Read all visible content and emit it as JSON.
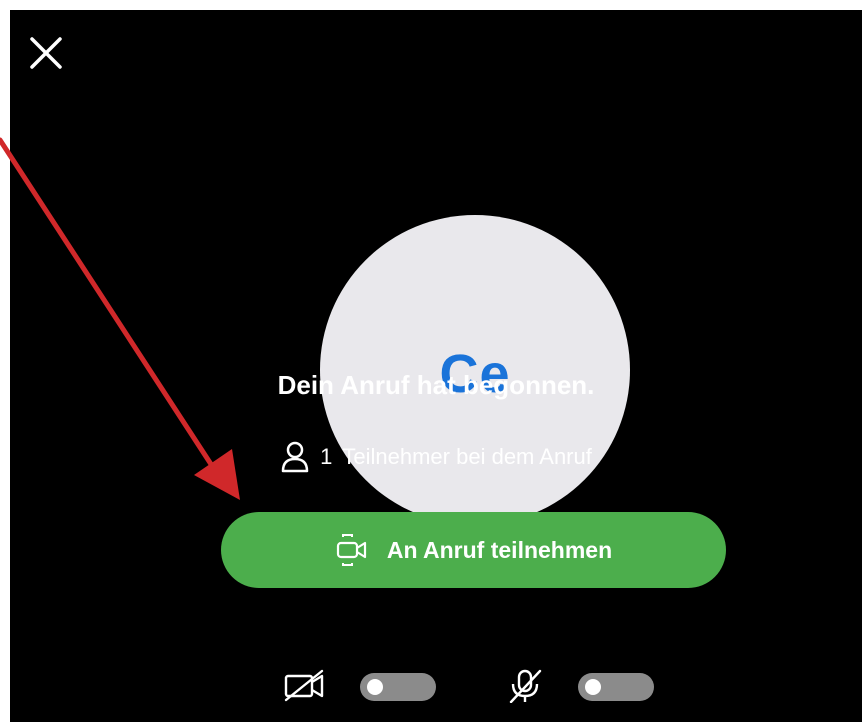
{
  "header": {
    "close_icon": "close-icon"
  },
  "avatar": {
    "initials": "Ce"
  },
  "call": {
    "headline": "Dein Anruf hat begonnen.",
    "participant_count": "1",
    "participant_text": "Teilnehmer bei dem Anruf",
    "participant_icon": "person-icon"
  },
  "join_button": {
    "label": "An Anruf teilnehmen",
    "icon": "video-camera-icon"
  },
  "controls": {
    "camera": {
      "icon": "camera-off-icon",
      "enabled": false
    },
    "microphone": {
      "icon": "microphone-off-icon",
      "enabled": false
    }
  },
  "colors": {
    "background": "#000000",
    "join_button": "#4cae4c",
    "avatar_bg": "#e9e8ec",
    "initials": "#1a73d9",
    "annotation_arrow": "#d0282a",
    "toggle_off": "#8b8b8b"
  }
}
